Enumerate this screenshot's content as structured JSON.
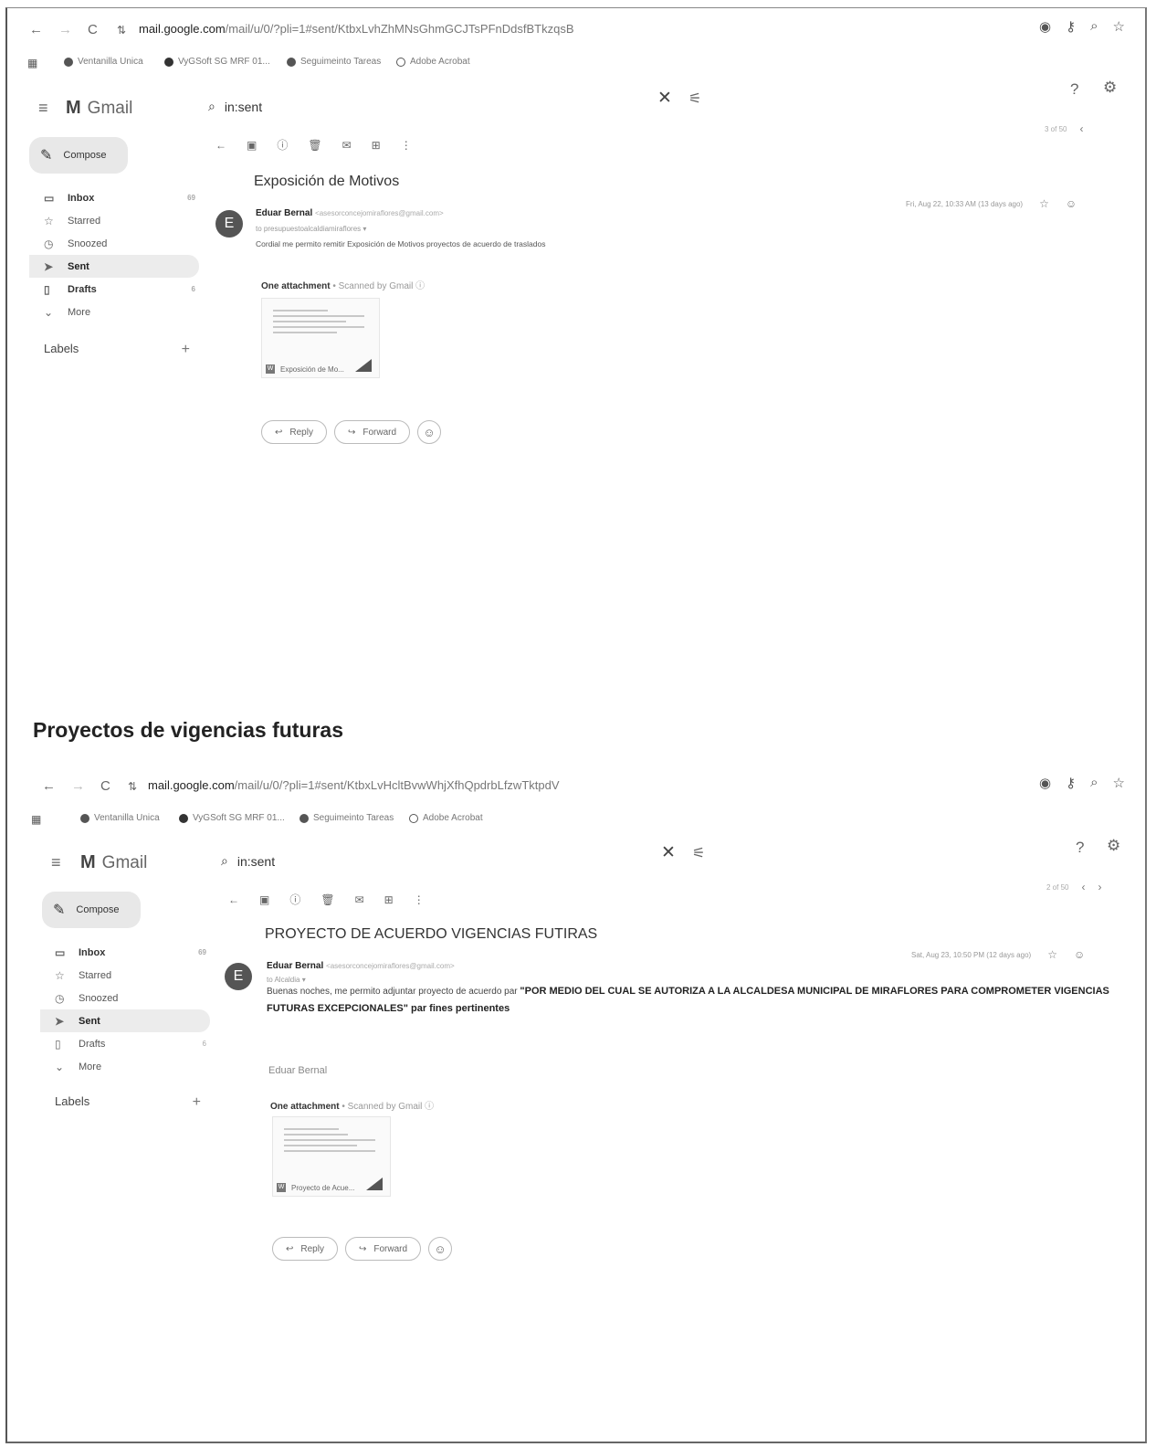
{
  "heading": "Proyectos de vigencias futuras",
  "screens": [
    {
      "url_host": "mail.google.com",
      "url_path": "/mail/u/0/?pli=1#sent/KtbxLvhZhMNsGhmGCJTsPFnDdsfBTkzqsB",
      "bookmarks": [
        "Ventanilla Unica",
        "VyGSoft SG MRF 01...",
        "Seguimeinto Tareas",
        "Adobe Acrobat"
      ],
      "gmail_title": "Gmail",
      "search_query": "in:sent",
      "compose_label": "Compose",
      "sidebar": [
        {
          "label": "Inbox",
          "count": "69"
        },
        {
          "label": "Starred",
          "count": ""
        },
        {
          "label": "Snoozed",
          "count": ""
        },
        {
          "label": "Sent",
          "count": ""
        },
        {
          "label": "Drafts",
          "count": "6"
        },
        {
          "label": "More",
          "count": ""
        }
      ],
      "labels_title": "Labels",
      "pager": "3 of 50",
      "subject": "Exposición de Motivos",
      "avatar_letter": "E",
      "sender_name": "Eduar Bernal",
      "sender_email": "<asesorconcejomiraflores@gmail.com>",
      "to_line": "to presupuestoalcaldiamiraflores",
      "date": "Fri, Aug 22, 10:33 AM (13 days ago)",
      "body": "Cordial me permito remitir Exposición de Motivos proyectos de acuerdo de traslados",
      "attachment_label": "One attachment",
      "scanned_label": "Scanned by Gmail",
      "attachment_name": "Exposición de Mo...",
      "reply_label": "Reply",
      "forward_label": "Forward"
    },
    {
      "url_host": "mail.google.com",
      "url_path": "/mail/u/0/?pli=1#sent/KtbxLvHcltBvwWhjXfhQpdrbLfzwTktpdV",
      "bookmarks": [
        "Ventanilla Unica",
        "VyGSoft SG MRF 01...",
        "Seguimeinto Tareas",
        "Adobe Acrobat"
      ],
      "gmail_title": "Gmail",
      "search_query": "in:sent",
      "compose_label": "Compose",
      "sidebar": [
        {
          "label": "Inbox",
          "count": "69"
        },
        {
          "label": "Starred",
          "count": ""
        },
        {
          "label": "Snoozed",
          "count": ""
        },
        {
          "label": "Sent",
          "count": ""
        },
        {
          "label": "Drafts",
          "count": "6"
        },
        {
          "label": "More",
          "count": ""
        }
      ],
      "labels_title": "Labels",
      "pager": "2 of 50",
      "subject": "PROYECTO DE ACUERDO VIGENCIAS FUTIRAS",
      "avatar_letter": "E",
      "sender_name": "Eduar Bernal",
      "sender_email": "<asesorconcejomiraflores@gmail.com>",
      "to_line": "to Alcaldia",
      "date": "Sat, Aug 23, 10:50 PM (12 days ago)",
      "body_intro": "Buenas noches, me permito adjuntar proyecto de acuerdo par ",
      "body_caps": "\"POR MEDIO DEL CUAL SE AUTORIZA A LA ALCALDESA MUNICIPAL DE MIRAFLORES PARA COMPROMETER VIGENCIAS FUTURAS EXCEPCIONALES\" par fines pertinentes",
      "signature": "Eduar Bernal",
      "attachment_label": "One attachment",
      "scanned_label": "Scanned by Gmail",
      "attachment_name": "Proyecto de Acue...",
      "reply_label": "Reply",
      "forward_label": "Forward"
    }
  ],
  "icons": {
    "back": "←",
    "forward": "→",
    "reload": "C",
    "site_info": "⇅",
    "eye": "◉",
    "key": "⚷",
    "zoom": "⌕",
    "star": "☆",
    "menu": "≡",
    "search": "⌕",
    "close": "✕",
    "tune": "⚟",
    "help": "?",
    "settings": "⚙",
    "pencil": "✎"
  }
}
